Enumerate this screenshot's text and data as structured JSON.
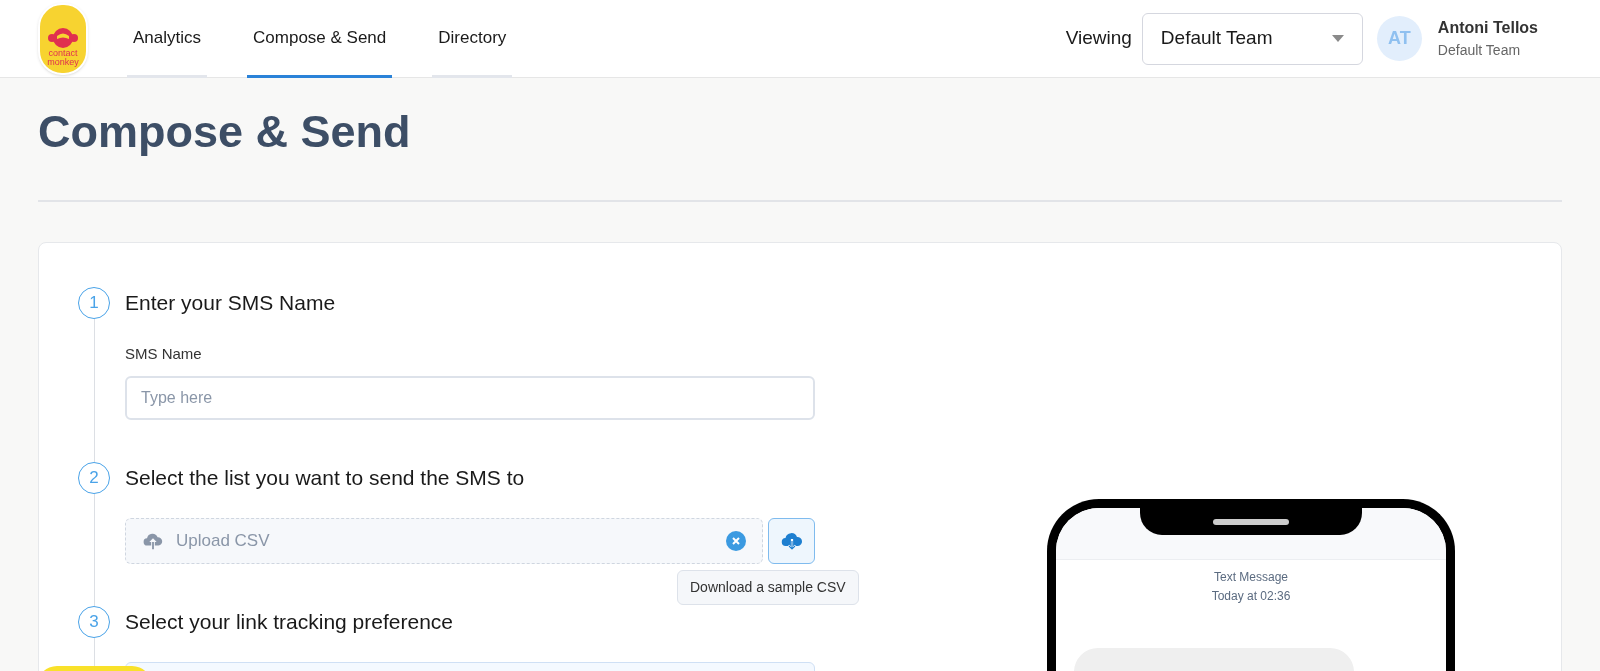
{
  "logo": {
    "lines": [
      "contact",
      "monkey"
    ]
  },
  "nav": {
    "tabs": [
      {
        "label": "Analytics",
        "selected": false
      },
      {
        "label": "Compose & Send",
        "selected": true
      },
      {
        "label": "Directory",
        "selected": false
      }
    ],
    "viewing_label": "Viewing",
    "team_select": {
      "value": "Default Team"
    },
    "user": {
      "initials": "AT",
      "name": "Antoni Tellos",
      "team": "Default Team"
    }
  },
  "page_title": "Compose & Send",
  "steps": [
    {
      "number": "1",
      "title": "Enter your SMS Name",
      "kind": "text",
      "label": "SMS Name",
      "placeholder": "Type here"
    },
    {
      "number": "2",
      "title": "Select the list you want to send the SMS to",
      "kind": "upload",
      "placeholder": "Upload CSV",
      "tooltip": "Download a sample CSV"
    },
    {
      "number": "3",
      "title": "Select your link tracking preference",
      "kind": "options"
    }
  ],
  "phone_preview": {
    "header": "Text Message",
    "time": "Today at 02:36"
  }
}
